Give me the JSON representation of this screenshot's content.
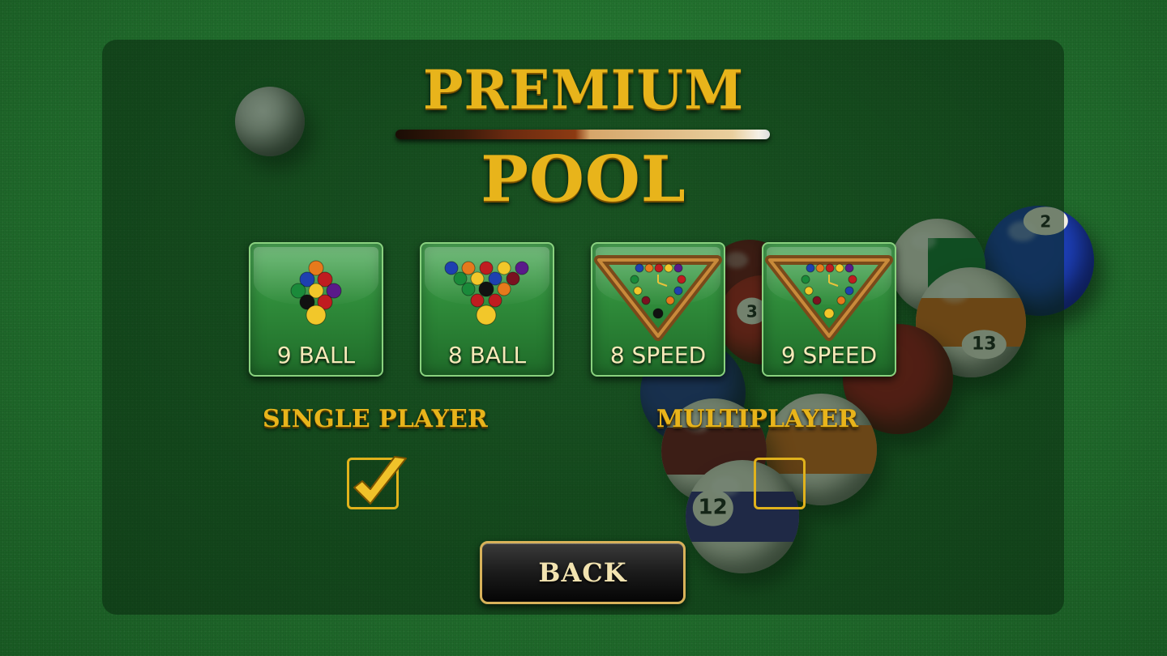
{
  "title": {
    "line1": "PREMIUM",
    "line2": "POOL"
  },
  "modes": [
    {
      "label": "9 BALL",
      "icon": "nine-ball-rack-icon"
    },
    {
      "label": "8 BALL",
      "icon": "eight-ball-rack-icon"
    },
    {
      "label": "8 SPEED",
      "icon": "speed-rack-clock-icon"
    },
    {
      "label": "9 SPEED",
      "icon": "speed-rack-clock-icon"
    }
  ],
  "players": {
    "single": {
      "label": "SINGLE PLAYER",
      "checked": true
    },
    "multi": {
      "label": "MULTIPLAYER",
      "checked": false
    }
  },
  "back_button": {
    "label": "BACK"
  },
  "background_ball_numbers": [
    "2",
    "13",
    "12",
    "3"
  ],
  "colors": {
    "gold": "#e8b41b",
    "felt": "#23722f",
    "tile": "#2f8b3a"
  }
}
